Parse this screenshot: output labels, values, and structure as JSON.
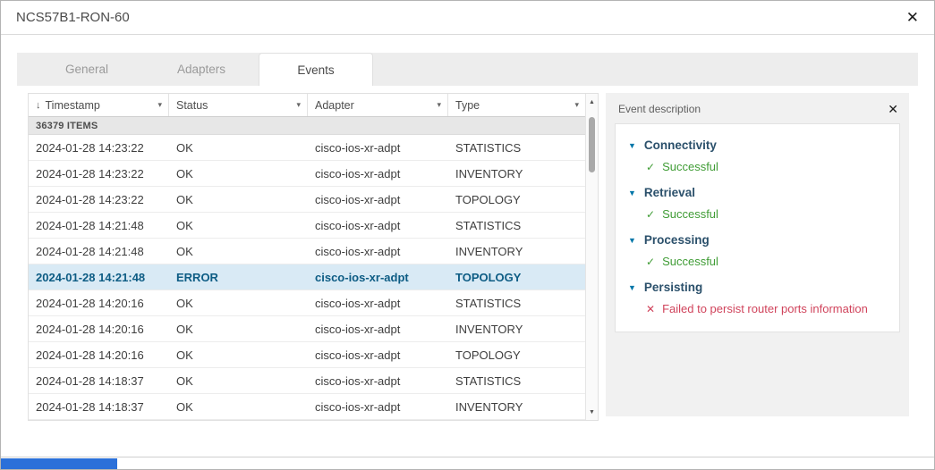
{
  "icons": {
    "close": "✕",
    "sort_desc": "↓",
    "dropdown": "▾",
    "caret_down": "▼",
    "check": "✓",
    "cross": "✕",
    "scroll_up": "▲",
    "scroll_down": "▼"
  },
  "modal": {
    "title": "NCS57B1-RON-60"
  },
  "tabs": [
    {
      "label": "General",
      "active": false
    },
    {
      "label": "Adapters",
      "active": false
    },
    {
      "label": "Events",
      "active": true
    }
  ],
  "table": {
    "items_count": "36379 ITEMS",
    "columns": [
      {
        "label": "Timestamp",
        "sorted": true
      },
      {
        "label": "Status",
        "sorted": false
      },
      {
        "label": "Adapter",
        "sorted": false
      },
      {
        "label": "Type",
        "sorted": false
      }
    ],
    "rows": [
      {
        "timestamp": "2024-01-28 14:23:22",
        "status": "OK",
        "adapter": "cisco-ios-xr-adpt",
        "type": "STATISTICS",
        "selected": false
      },
      {
        "timestamp": "2024-01-28 14:23:22",
        "status": "OK",
        "adapter": "cisco-ios-xr-adpt",
        "type": "INVENTORY",
        "selected": false
      },
      {
        "timestamp": "2024-01-28 14:23:22",
        "status": "OK",
        "adapter": "cisco-ios-xr-adpt",
        "type": "TOPOLOGY",
        "selected": false
      },
      {
        "timestamp": "2024-01-28 14:21:48",
        "status": "OK",
        "adapter": "cisco-ios-xr-adpt",
        "type": "STATISTICS",
        "selected": false
      },
      {
        "timestamp": "2024-01-28 14:21:48",
        "status": "OK",
        "adapter": "cisco-ios-xr-adpt",
        "type": "INVENTORY",
        "selected": false
      },
      {
        "timestamp": "2024-01-28 14:21:48",
        "status": "ERROR",
        "adapter": "cisco-ios-xr-adpt",
        "type": "TOPOLOGY",
        "selected": true
      },
      {
        "timestamp": "2024-01-28 14:20:16",
        "status": "OK",
        "adapter": "cisco-ios-xr-adpt",
        "type": "STATISTICS",
        "selected": false
      },
      {
        "timestamp": "2024-01-28 14:20:16",
        "status": "OK",
        "adapter": "cisco-ios-xr-adpt",
        "type": "INVENTORY",
        "selected": false
      },
      {
        "timestamp": "2024-01-28 14:20:16",
        "status": "OK",
        "adapter": "cisco-ios-xr-adpt",
        "type": "TOPOLOGY",
        "selected": false
      },
      {
        "timestamp": "2024-01-28 14:18:37",
        "status": "OK",
        "adapter": "cisco-ios-xr-adpt",
        "type": "STATISTICS",
        "selected": false
      },
      {
        "timestamp": "2024-01-28 14:18:37",
        "status": "OK",
        "adapter": "cisco-ios-xr-adpt",
        "type": "INVENTORY",
        "selected": false
      }
    ]
  },
  "event_description": {
    "title": "Event description",
    "sections": [
      {
        "name": "Connectivity",
        "status": "Successful",
        "ok": true
      },
      {
        "name": "Retrieval",
        "status": "Successful",
        "ok": true
      },
      {
        "name": "Processing",
        "status": "Successful",
        "ok": true
      },
      {
        "name": "Persisting",
        "status": "Failed to persist router ports information",
        "ok": false
      }
    ]
  },
  "colors": {
    "accent_blue": "#0076a8",
    "success_green": "#3f9c35",
    "error_red": "#d0435b",
    "selected_row_bg": "#d9eaf5",
    "selected_row_text": "#0d5c84"
  }
}
